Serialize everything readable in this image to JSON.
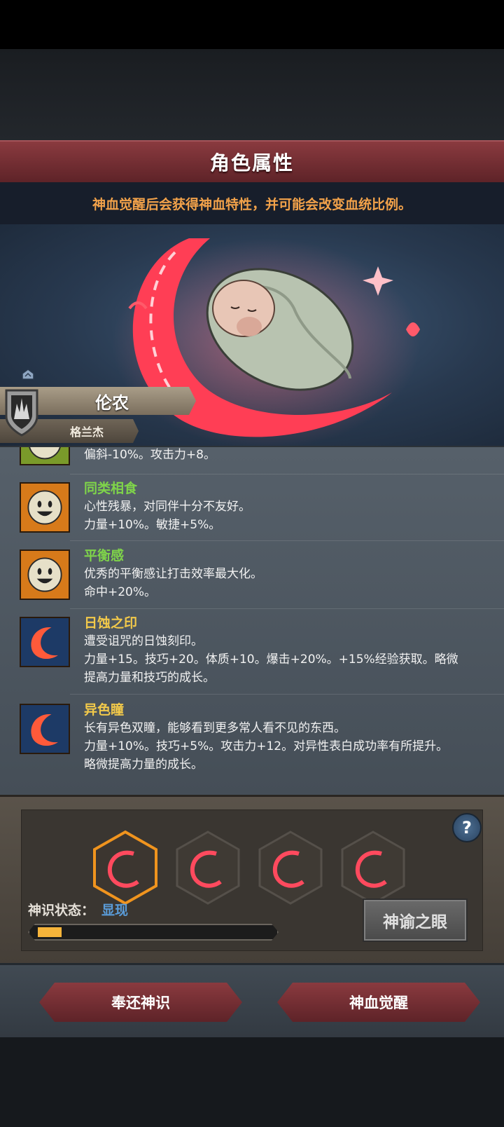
{
  "header": {
    "title": "角色属性",
    "subtitle": "神血觉醒后会获得神血特性，并可能会改变血统比例。"
  },
  "character": {
    "name": "伦农",
    "origin": "格兰杰"
  },
  "traits": [
    {
      "name": "",
      "name_color": "#7fd44a",
      "desc1": "偏斜-10%。攻击力+8。",
      "icon": "goblin-face-icon",
      "icon_bg": "#7a9a2a"
    },
    {
      "name": "同类相食",
      "name_color": "#7fd44a",
      "desc1": "心性残暴，对同伴十分不友好。",
      "desc2": "力量+10%。敏捷+5%。",
      "icon": "smiley-face-icon",
      "icon_bg": "#d77a1a"
    },
    {
      "name": "平衡感",
      "name_color": "#7fd44a",
      "desc1": "优秀的平衡感让打击效率最大化。",
      "desc2": "命中+20%。",
      "icon": "smiley-face-icon",
      "icon_bg": "#d77a1a"
    },
    {
      "name": "日蚀之印",
      "name_color": "#f2c94a",
      "desc1": "遭受诅咒的日蚀刻印。",
      "desc2": "力量+15。技巧+20。体质+10。爆击+20%。+15%经验获取。略微",
      "desc3": "提高力量和技巧的成长。",
      "icon": "crescent-mark-icon",
      "icon_bg": "#1d3a66"
    },
    {
      "name": "异色瞳",
      "name_color": "#f2c94a",
      "desc1": "长有异色双瞳，能够看到更多常人看不见的东西。",
      "desc2": "力量+10%。技巧+5%。攻击力+12。对异性表白成功率有所提升。",
      "desc3": "略微提高力量的成长。",
      "icon": "crescent-mark-icon",
      "icon_bg": "#1d3a66"
    }
  ],
  "awakening": {
    "slots": [
      "selected",
      "normal",
      "normal",
      "normal"
    ],
    "status_label": "神识状态：",
    "status_value": "显现",
    "progress": 0.1,
    "eye_button": "神谕之眼",
    "help": "?"
  },
  "actions": {
    "return_label": "奉还神识",
    "awaken_label": "神血觉醒"
  },
  "colors": {
    "accent_red": "#8a3a3f",
    "title_gold": "#f2a24a",
    "progress": "#f6b43a"
  }
}
